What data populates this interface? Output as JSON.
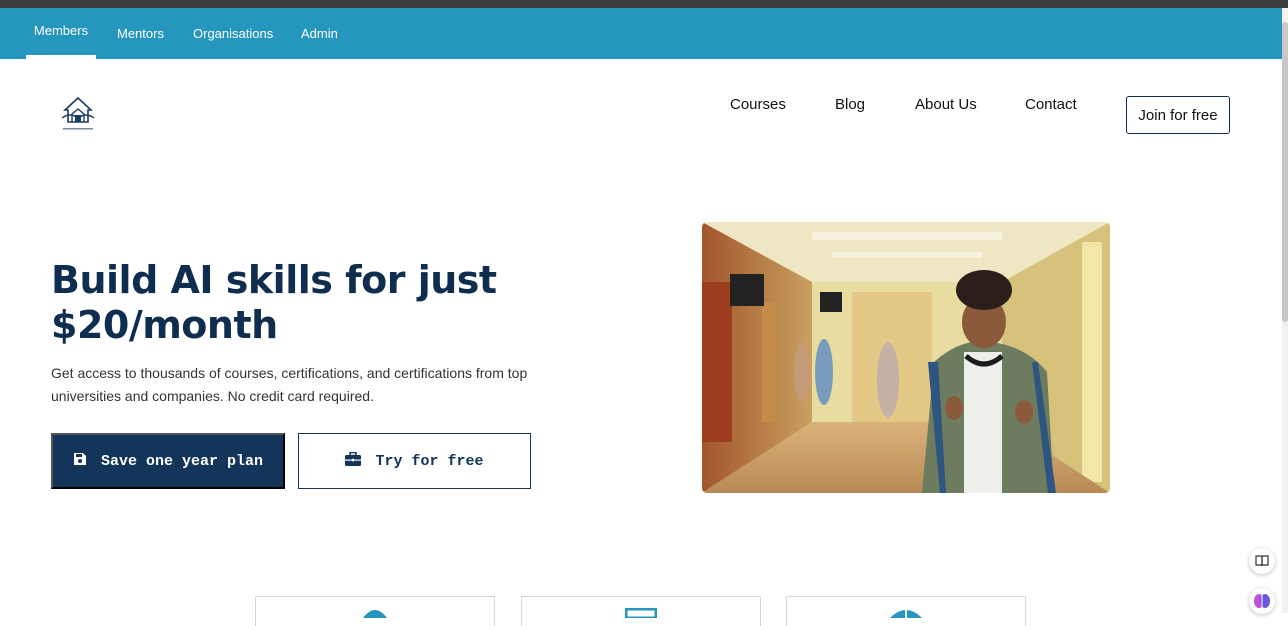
{
  "topnav": {
    "tabs": [
      {
        "label": "Members",
        "active": true
      },
      {
        "label": "Mentors",
        "active": false
      },
      {
        "label": "Organisations",
        "active": false
      },
      {
        "label": "Admin",
        "active": false
      }
    ]
  },
  "header": {
    "logo_icon": "school-logo-icon",
    "nav": [
      "Courses",
      "Blog",
      "About Us",
      "Contact"
    ],
    "join_label": "Join for free"
  },
  "hero": {
    "title": "Build AI skills for just $20/month",
    "subtitle": "Get access to thousands of courses, certifications, and certifications from top universities and companies. No credit card required.",
    "primary_button": {
      "label": "Save one year plan",
      "icon": "save-icon"
    },
    "secondary_button": {
      "label": "Try for free",
      "icon": "briefcase-icon"
    },
    "image": "student-in-hallway-photo"
  },
  "features": {
    "cards": [
      {
        "icon": "globe-icon"
      },
      {
        "icon": "monitor-icon"
      },
      {
        "icon": "world-icon"
      }
    ]
  },
  "floating": {
    "reader_icon": "reader-icon",
    "brain_icon": "brain-icon"
  },
  "colors": {
    "topnav": "#2596be",
    "brand_dark": "#123559",
    "title": "#0f2d4f",
    "accent": "#2596be"
  }
}
